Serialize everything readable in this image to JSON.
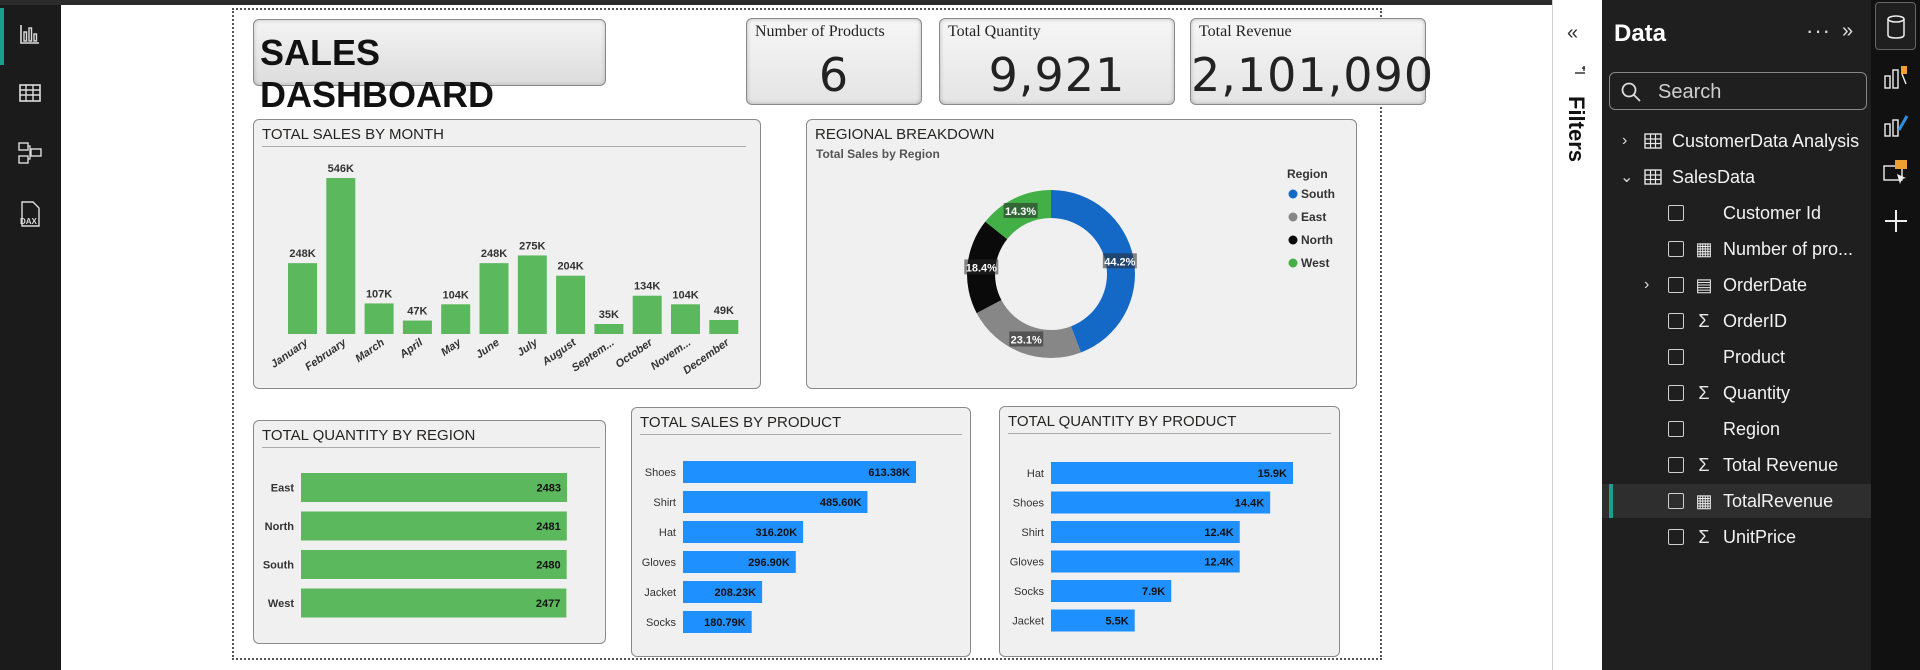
{
  "kpis": [
    {
      "label": "Number of Products",
      "value": "6"
    },
    {
      "label": "Total Quantity",
      "value": "9,921"
    },
    {
      "label": "Total Revenue",
      "value": "2,101,090"
    }
  ],
  "dashboard_title": "SALES DASHBOARD",
  "visuals": {
    "sales_by_month_title": "TOTAL SALES BY MONTH",
    "regional_title": "REGIONAL BREAKDOWN",
    "regional_subtitle": "Total Sales by Region",
    "qty_region_title": "TOTAL QUANTITY BY REGION",
    "sales_product_title": "TOTAL SALES BY PRODUCT",
    "qty_product_title": "TOTAL QUANTITY BY PRODUCT"
  },
  "chart_data": [
    {
      "type": "bar",
      "title": "TOTAL SALES BY MONTH",
      "categories": [
        "January",
        "February",
        "March",
        "April",
        "May",
        "June",
        "July",
        "August",
        "Septem...",
        "October",
        "Novem...",
        "December"
      ],
      "values": [
        248000,
        546000,
        107000,
        47000,
        104000,
        248000,
        275000,
        204000,
        35000,
        134000,
        104000,
        49000
      ],
      "data_labels": [
        "248K",
        "546K",
        "107K",
        "47K",
        "104K",
        "248K",
        "275K",
        "204K",
        "35K",
        "134K",
        "104K",
        "49K"
      ],
      "color": "#5cb85c"
    },
    {
      "type": "pie",
      "title": "Total Sales by Region",
      "legend_title": "Region",
      "legend_position": "right",
      "slices": [
        {
          "name": "South",
          "percent": 44.2,
          "label": "44.2%",
          "color": "#1469c7"
        },
        {
          "name": "East",
          "percent": 23.1,
          "label": "23.1%",
          "color": "#878787"
        },
        {
          "name": "North",
          "percent": 18.4,
          "label": "18.4%",
          "color": "#0a0a0a"
        },
        {
          "name": "West",
          "percent": 14.3,
          "label": "14.3%",
          "color": "#43b047"
        }
      ]
    },
    {
      "type": "bar",
      "orientation": "horizontal",
      "title": "TOTAL QUANTITY BY REGION",
      "categories": [
        "East",
        "North",
        "South",
        "West"
      ],
      "values": [
        2483,
        2481,
        2480,
        2477
      ],
      "data_labels": [
        "2483",
        "2481",
        "2480",
        "2477"
      ],
      "color": "#5cb85c"
    },
    {
      "type": "bar",
      "orientation": "horizontal",
      "title": "TOTAL SALES BY PRODUCT",
      "categories": [
        "Shoes",
        "Shirt",
        "Hat",
        "Gloves",
        "Jacket",
        "Socks"
      ],
      "values": [
        613380,
        485600,
        316200,
        296900,
        208230,
        180790
      ],
      "data_labels": [
        "613.38K",
        "485.60K",
        "316.20K",
        "296.90K",
        "208.23K",
        "180.79K"
      ],
      "color": "#1e90ff"
    },
    {
      "type": "bar",
      "orientation": "horizontal",
      "title": "TOTAL QUANTITY BY PRODUCT",
      "categories": [
        "Hat",
        "Shoes",
        "Shirt",
        "Gloves",
        "Socks",
        "Jacket"
      ],
      "values": [
        15900,
        14400,
        12400,
        12400,
        7900,
        5500
      ],
      "data_labels": [
        "15.9K",
        "14.4K",
        "12.4K",
        "12.4K",
        "7.9K",
        "5.5K"
      ],
      "color": "#1e90ff"
    }
  ],
  "filters_pane": {
    "label": "Filters",
    "collapse_glyph": "«"
  },
  "data_pane": {
    "title": "Data",
    "more_glyph": "···",
    "expand_glyph": "»",
    "search_placeholder": "Search",
    "tables": [
      {
        "name": "CustomerData Analysis",
        "expanded": false
      },
      {
        "name": "SalesData",
        "expanded": true
      }
    ],
    "fields": [
      {
        "name": "Customer Id",
        "icon": ""
      },
      {
        "name": "Number of pro...",
        "icon": "calculator-icon"
      },
      {
        "name": "OrderDate",
        "icon": "calendar-icon",
        "expandable": true
      },
      {
        "name": "OrderID",
        "icon": "sigma-icon"
      },
      {
        "name": "Product",
        "icon": ""
      },
      {
        "name": "Quantity",
        "icon": "sigma-icon"
      },
      {
        "name": "Region",
        "icon": ""
      },
      {
        "name": "Total Revenue",
        "icon": "sigma-icon"
      },
      {
        "name": "TotalRevenue",
        "icon": "calculator-icon",
        "selected": true
      },
      {
        "name": "UnitPrice",
        "icon": "sigma-icon"
      }
    ]
  },
  "colors": {
    "accent": "#1b9e8f",
    "bar_green": "#5cb85c",
    "bar_blue": "#1e90ff"
  }
}
